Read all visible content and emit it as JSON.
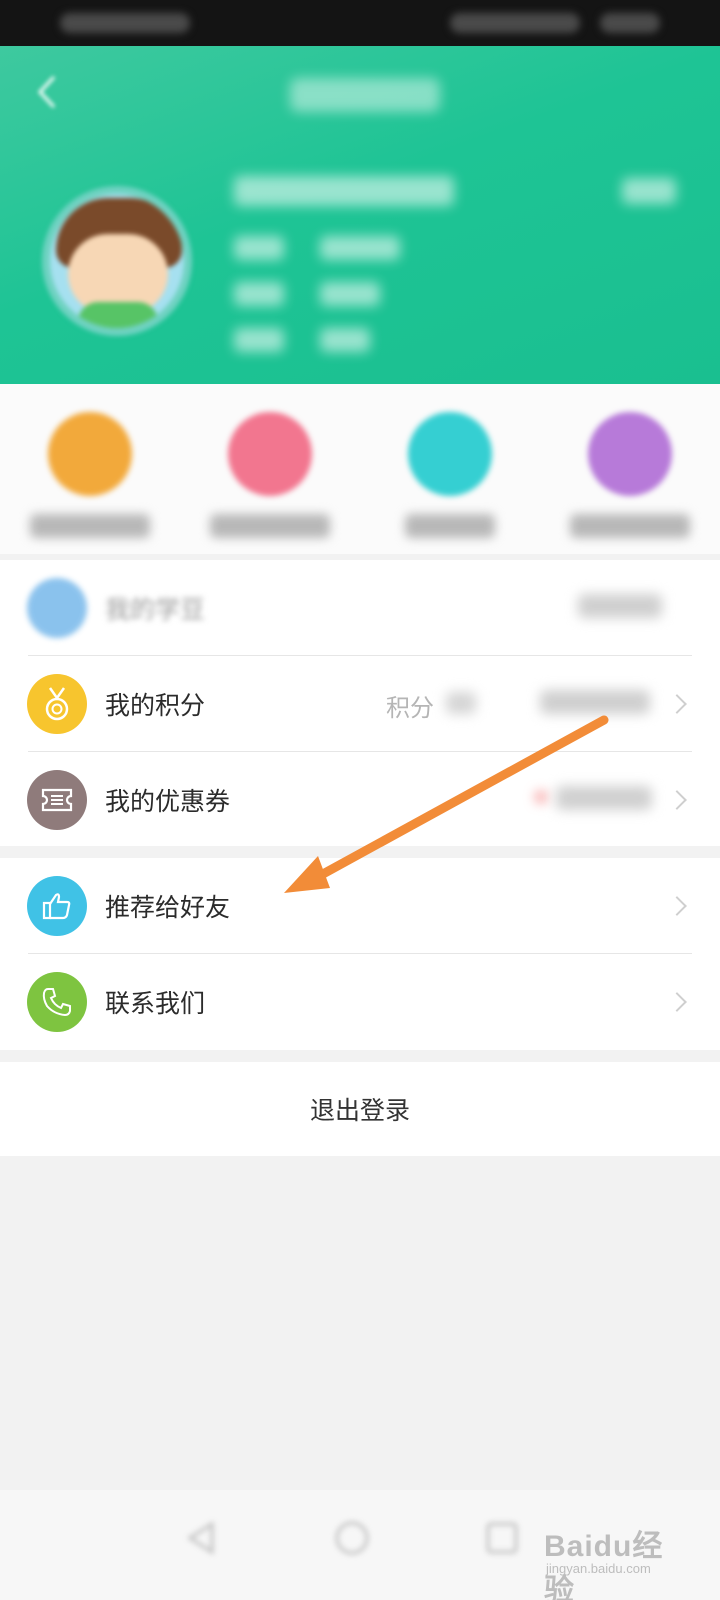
{
  "menu": {
    "group1": [
      {
        "label": "我的学豆",
        "icon": "coin-icon",
        "color": "#5aa9e6"
      },
      {
        "label": "我的积分",
        "icon": "medal-icon",
        "color": "#f7c52e",
        "right_text": "积分"
      },
      {
        "label": "我的优惠券",
        "icon": "ticket-icon",
        "color": "#8f7b7b"
      }
    ],
    "group2": [
      {
        "label": "推荐给好友",
        "icon": "thumbs-up-icon",
        "color": "#40c2e6"
      },
      {
        "label": "联系我们",
        "icon": "phone-icon",
        "color": "#7ec440"
      }
    ]
  },
  "logout": {
    "label": "退出登录"
  },
  "quick_actions": [
    {
      "icon": "orders-icon",
      "color": "#f2a93b"
    },
    {
      "icon": "favorites-icon",
      "color": "#f2768f"
    },
    {
      "icon": "history-icon",
      "color": "#35cfd2"
    },
    {
      "icon": "settings-icon",
      "color": "#b77ad9"
    }
  ],
  "colors": {
    "header_green": "#1ec495",
    "annotation_arrow": "#f28c38"
  },
  "watermark": {
    "text": "Baidu经验",
    "url_text": "jingyan.baidu.com"
  }
}
